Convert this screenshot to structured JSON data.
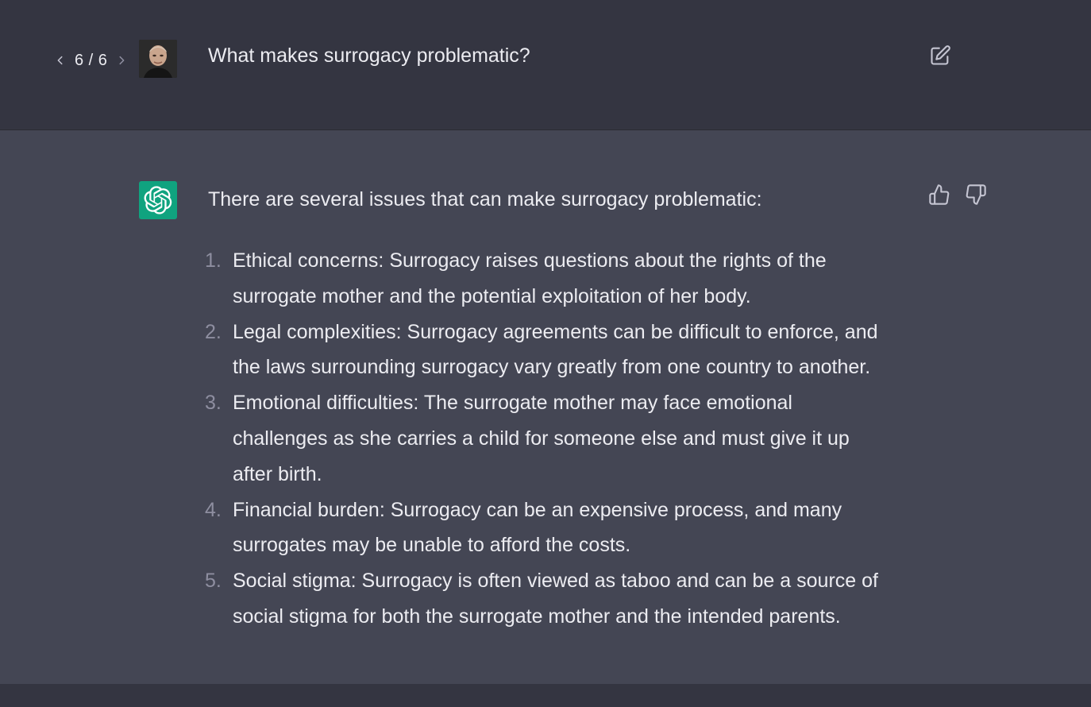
{
  "user_message": {
    "pager": {
      "prev_icon": "chevron-left-icon",
      "count": "6 / 6",
      "next_icon": "chevron-right-icon"
    },
    "avatar": "user-avatar-photo",
    "text": "What makes surrogacy problematic?",
    "edit_icon": "edit-icon"
  },
  "assistant_message": {
    "avatar_icon": "openai-logo-icon",
    "avatar_color": "#10a37f",
    "intro": "There are several issues that can make surrogacy problematic:",
    "items": [
      {
        "number": "1.",
        "lines": [
          "Ethical concerns: Surrogacy raises questions about the rights of the",
          "surrogate mother and the potential exploitation of her body."
        ]
      },
      {
        "number": "2.",
        "lines": [
          "Legal complexities: Surrogacy agreements can be difficult to enforce, and",
          "the laws surrounding surrogacy vary greatly from one country to another."
        ]
      },
      {
        "number": "3.",
        "lines": [
          "Emotional difficulties: The surrogate mother may face emotional",
          "challenges as she carries a child for someone else and must give it up",
          "after birth."
        ]
      },
      {
        "number": "4.",
        "lines": [
          "Financial burden: Surrogacy can be an expensive process, and many",
          "surrogates may be unable to afford the costs."
        ]
      },
      {
        "number": "5.",
        "lines": [
          "Social stigma: Surrogacy is often viewed as taboo and can be a source of",
          "social stigma for both the surrogate mother and the intended parents."
        ]
      }
    ],
    "feedback": {
      "thumbs_up_icon": "thumbs-up-icon",
      "thumbs_down_icon": "thumbs-down-icon"
    }
  },
  "colors": {
    "user_bg": "#343541",
    "assistant_bg": "#444654",
    "text": "#ececf1",
    "muted": "#8e8ea0",
    "accent": "#10a37f"
  }
}
